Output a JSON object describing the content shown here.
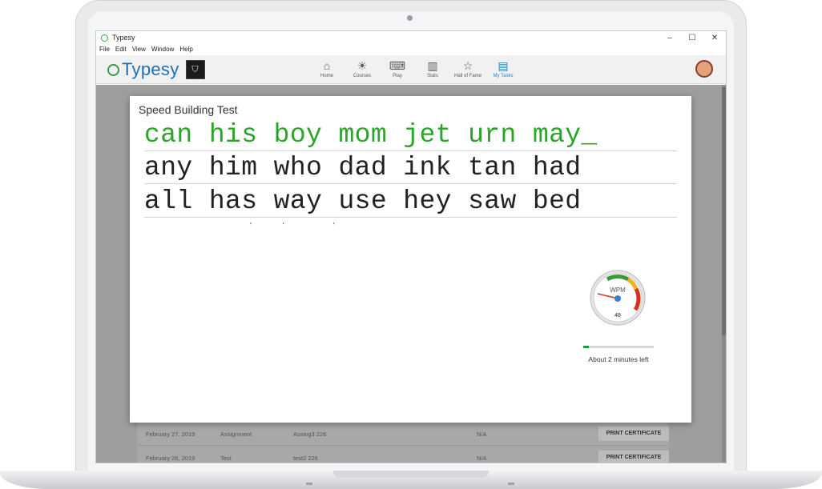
{
  "window": {
    "title": "Typesy",
    "controls": {
      "minimize": "–",
      "maximize": "☐",
      "close": "✕"
    }
  },
  "menu": [
    "File",
    "Edit",
    "View",
    "Window",
    "Help"
  ],
  "header": {
    "logo_text": "Typesy",
    "badge_icon": "shield-icon",
    "nav": [
      {
        "label": "Home",
        "icon": "home-icon",
        "glyph": "⌂"
      },
      {
        "label": "Courses",
        "icon": "lightbulb-icon",
        "glyph": "☀"
      },
      {
        "label": "Play",
        "icon": "keyboard-icon",
        "glyph": "⌨"
      },
      {
        "label": "Stats",
        "icon": "chart-icon",
        "glyph": "▥"
      },
      {
        "label": "Hall of Fame",
        "icon": "star-icon",
        "glyph": "☆"
      },
      {
        "label": "My Tasks",
        "icon": "clipboard-icon",
        "glyph": "▤"
      }
    ],
    "active_nav": "My Tasks"
  },
  "background_table": {
    "rows": [
      {
        "date": "February 27, 2019",
        "type": "Assignment",
        "name": "Assing3 226",
        "score": "N/A",
        "action": "PRINT CERTIFICATE"
      },
      {
        "date": "February 26, 2019",
        "type": "Test",
        "name": "test2 226",
        "score": "N/A",
        "action": "PRINT CERTIFICATE"
      }
    ]
  },
  "modal": {
    "title": "Speed Building Test",
    "lines": [
      "can his boy mom jet urn may_",
      "any him who dad ink tan had",
      "all has way use hey saw bed"
    ],
    "typed_color": "#2aa52a",
    "gauge": {
      "label": "WPM",
      "value": "48"
    },
    "progress_fraction": 0.08,
    "time_left": "About 2 minutes left"
  }
}
